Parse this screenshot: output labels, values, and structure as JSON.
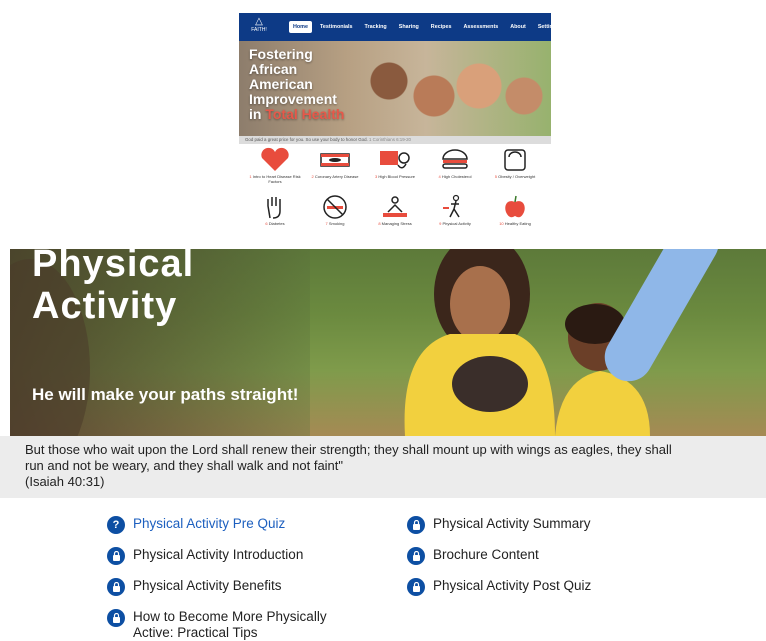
{
  "thumbnail": {
    "logo_text": "FAITH!",
    "nav": [
      "Home",
      "Testimonials",
      "Tracking",
      "Sharing",
      "Recipes",
      "Assessments",
      "About",
      "Settings"
    ],
    "active_nav": "Home",
    "hero_lines": [
      "Fostering",
      "African",
      "American",
      "Improvement",
      "in "
    ],
    "hero_highlight": "Total Health",
    "verse": "God paid a great price for you. So use your body to honor God.",
    "verse_ref": "1 Corinthians 6:19-20",
    "modules": [
      {
        "num": "1",
        "label": "Intro to Heart Disease Risk Factors",
        "icon": "heart-icon"
      },
      {
        "num": "2",
        "label": "Coronary Artery Disease",
        "icon": "artery-icon"
      },
      {
        "num": "3",
        "label": "High Blood Pressure",
        "icon": "blood-pressure-cuff-icon"
      },
      {
        "num": "4",
        "label": "High Cholesterol",
        "icon": "burger-icon"
      },
      {
        "num": "5",
        "label": "Obesity / Overweight",
        "icon": "scale-icon"
      },
      {
        "num": "6",
        "label": "Diabetes",
        "icon": "hand-icon"
      },
      {
        "num": "7",
        "label": "Smoking",
        "icon": "no-smoking-icon"
      },
      {
        "num": "8",
        "label": "Managing Stress",
        "icon": "meditation-icon"
      },
      {
        "num": "9",
        "label": "Physical Activity",
        "icon": "running-icon"
      },
      {
        "num": "10",
        "label": "Healthy Eating",
        "icon": "apple-icon"
      }
    ],
    "colors": {
      "nav_bg": "#0d3a86",
      "accent": "#e84c3d"
    }
  },
  "banner": {
    "title_line1": "Physical",
    "title_line2": "Activity",
    "subtitle": "He will make your paths straight!"
  },
  "verse": {
    "line1": "But those who wait upon the Lord shall renew their strength; they shall mount up with wings as eagles, they shall",
    "line2": "run and not be weary, and they shall walk and not faint\"",
    "ref": "(Isaiah 40:31)"
  },
  "links": {
    "left": [
      {
        "label": "Physical Activity Pre Quiz",
        "icon": "question-icon",
        "badge": "?"
      },
      {
        "label": "Physical Activity Introduction",
        "icon": "lock-icon"
      },
      {
        "label": "Physical Activity Benefits",
        "icon": "lock-icon"
      },
      {
        "label": "How to Become More Physically",
        "label2": "Active: Practical Tips",
        "icon": "lock-icon"
      }
    ],
    "right": [
      {
        "label": "Physical Activity Summary",
        "icon": "lock-icon"
      },
      {
        "label": "Brochure Content",
        "icon": "lock-icon"
      },
      {
        "label": "Physical Activity Post Quiz",
        "icon": "lock-icon"
      }
    ],
    "colors": {
      "badge": "#0d4fa3",
      "active_link": "#1c5fbf"
    }
  }
}
